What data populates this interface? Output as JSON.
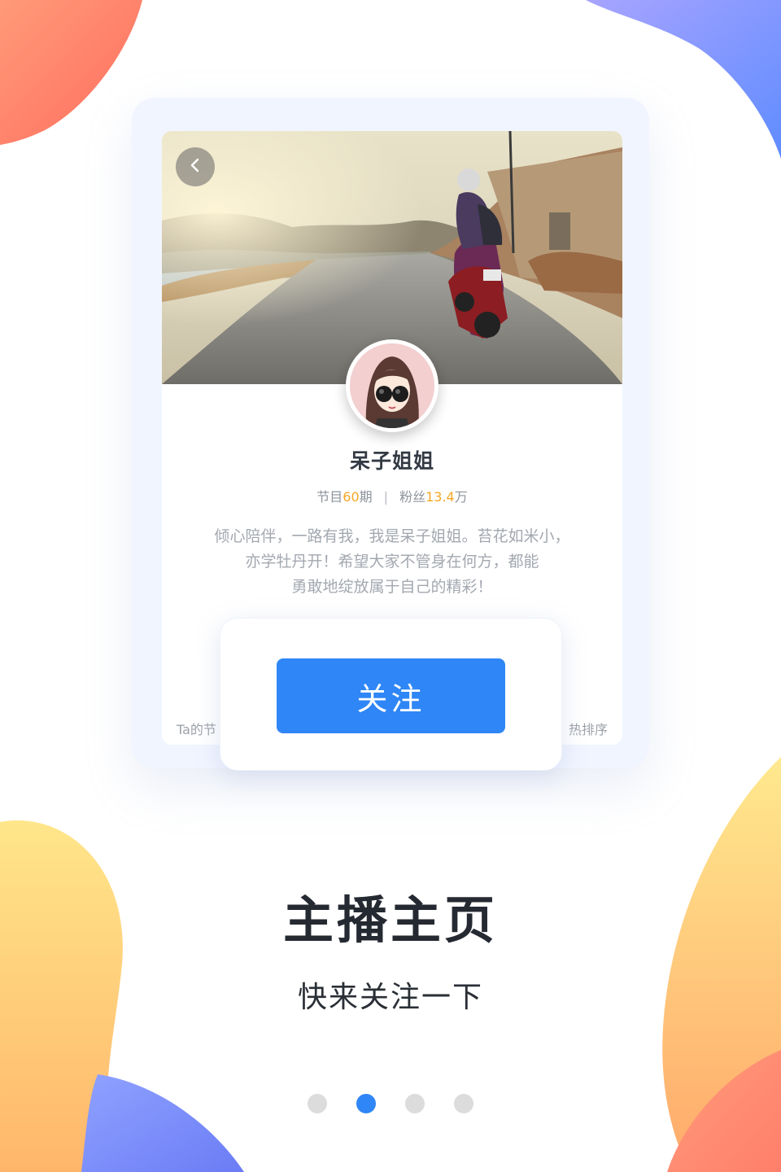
{
  "profile": {
    "name": "呆子姐姐",
    "stats_episodes_label": "节目",
    "stats_episodes_value": "60",
    "stats_episodes_unit": "期",
    "stats_separator": "|",
    "stats_fans_label": "粉丝",
    "stats_fans_value": "13.4",
    "stats_fans_unit": "万",
    "bio_lines": [
      "倾心陪伴，一路有我，我是呆子姐姐。苔花如米小，",
      "亦学牡丹开！希望大家不管身在何方，都能",
      "勇敢地绽放属于自己的精彩！"
    ],
    "list_left_label": "Ta的节",
    "list_right_label": "热排序"
  },
  "popup": {
    "follow_label": "关注"
  },
  "onboarding": {
    "title": "主播主页",
    "subtitle": "快来关注一下",
    "page_count": 4,
    "active_page": 2
  },
  "colors": {
    "accent": "#2f86f6",
    "highlight": "#f5a623",
    "card_bg": "#f1f5ff"
  },
  "icons": {
    "back": "chevron-left-icon"
  }
}
